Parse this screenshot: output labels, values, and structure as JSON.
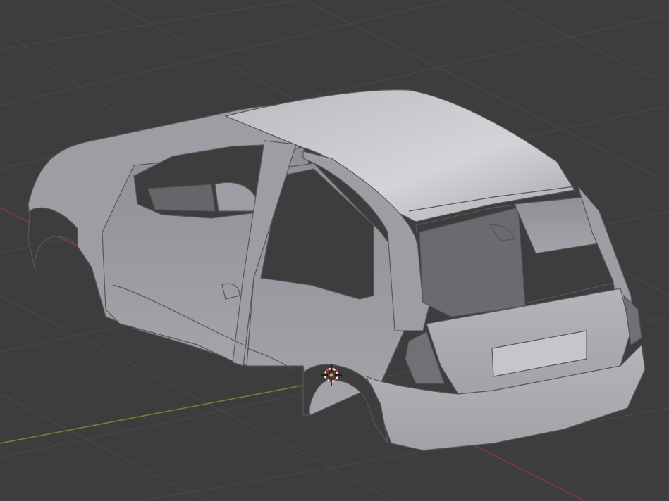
{
  "viewport": {
    "background": "#3d3d3d",
    "grid_color": "#4a4a4a",
    "x_axis_color": "#8a3a3f",
    "y_axis_color": "#6a8a34"
  },
  "model": {
    "body_color": "#9c9ea3",
    "highlight_color": "#c4c6ca",
    "shadow_color": "#6f7176",
    "interior_color": "#3d3d3d",
    "edge_color": "#55575b"
  },
  "cursor_3d": {
    "ring_colors": [
      "#e04a3a",
      "#f2f2f2"
    ]
  },
  "origin": {
    "color": "#f5a623"
  }
}
